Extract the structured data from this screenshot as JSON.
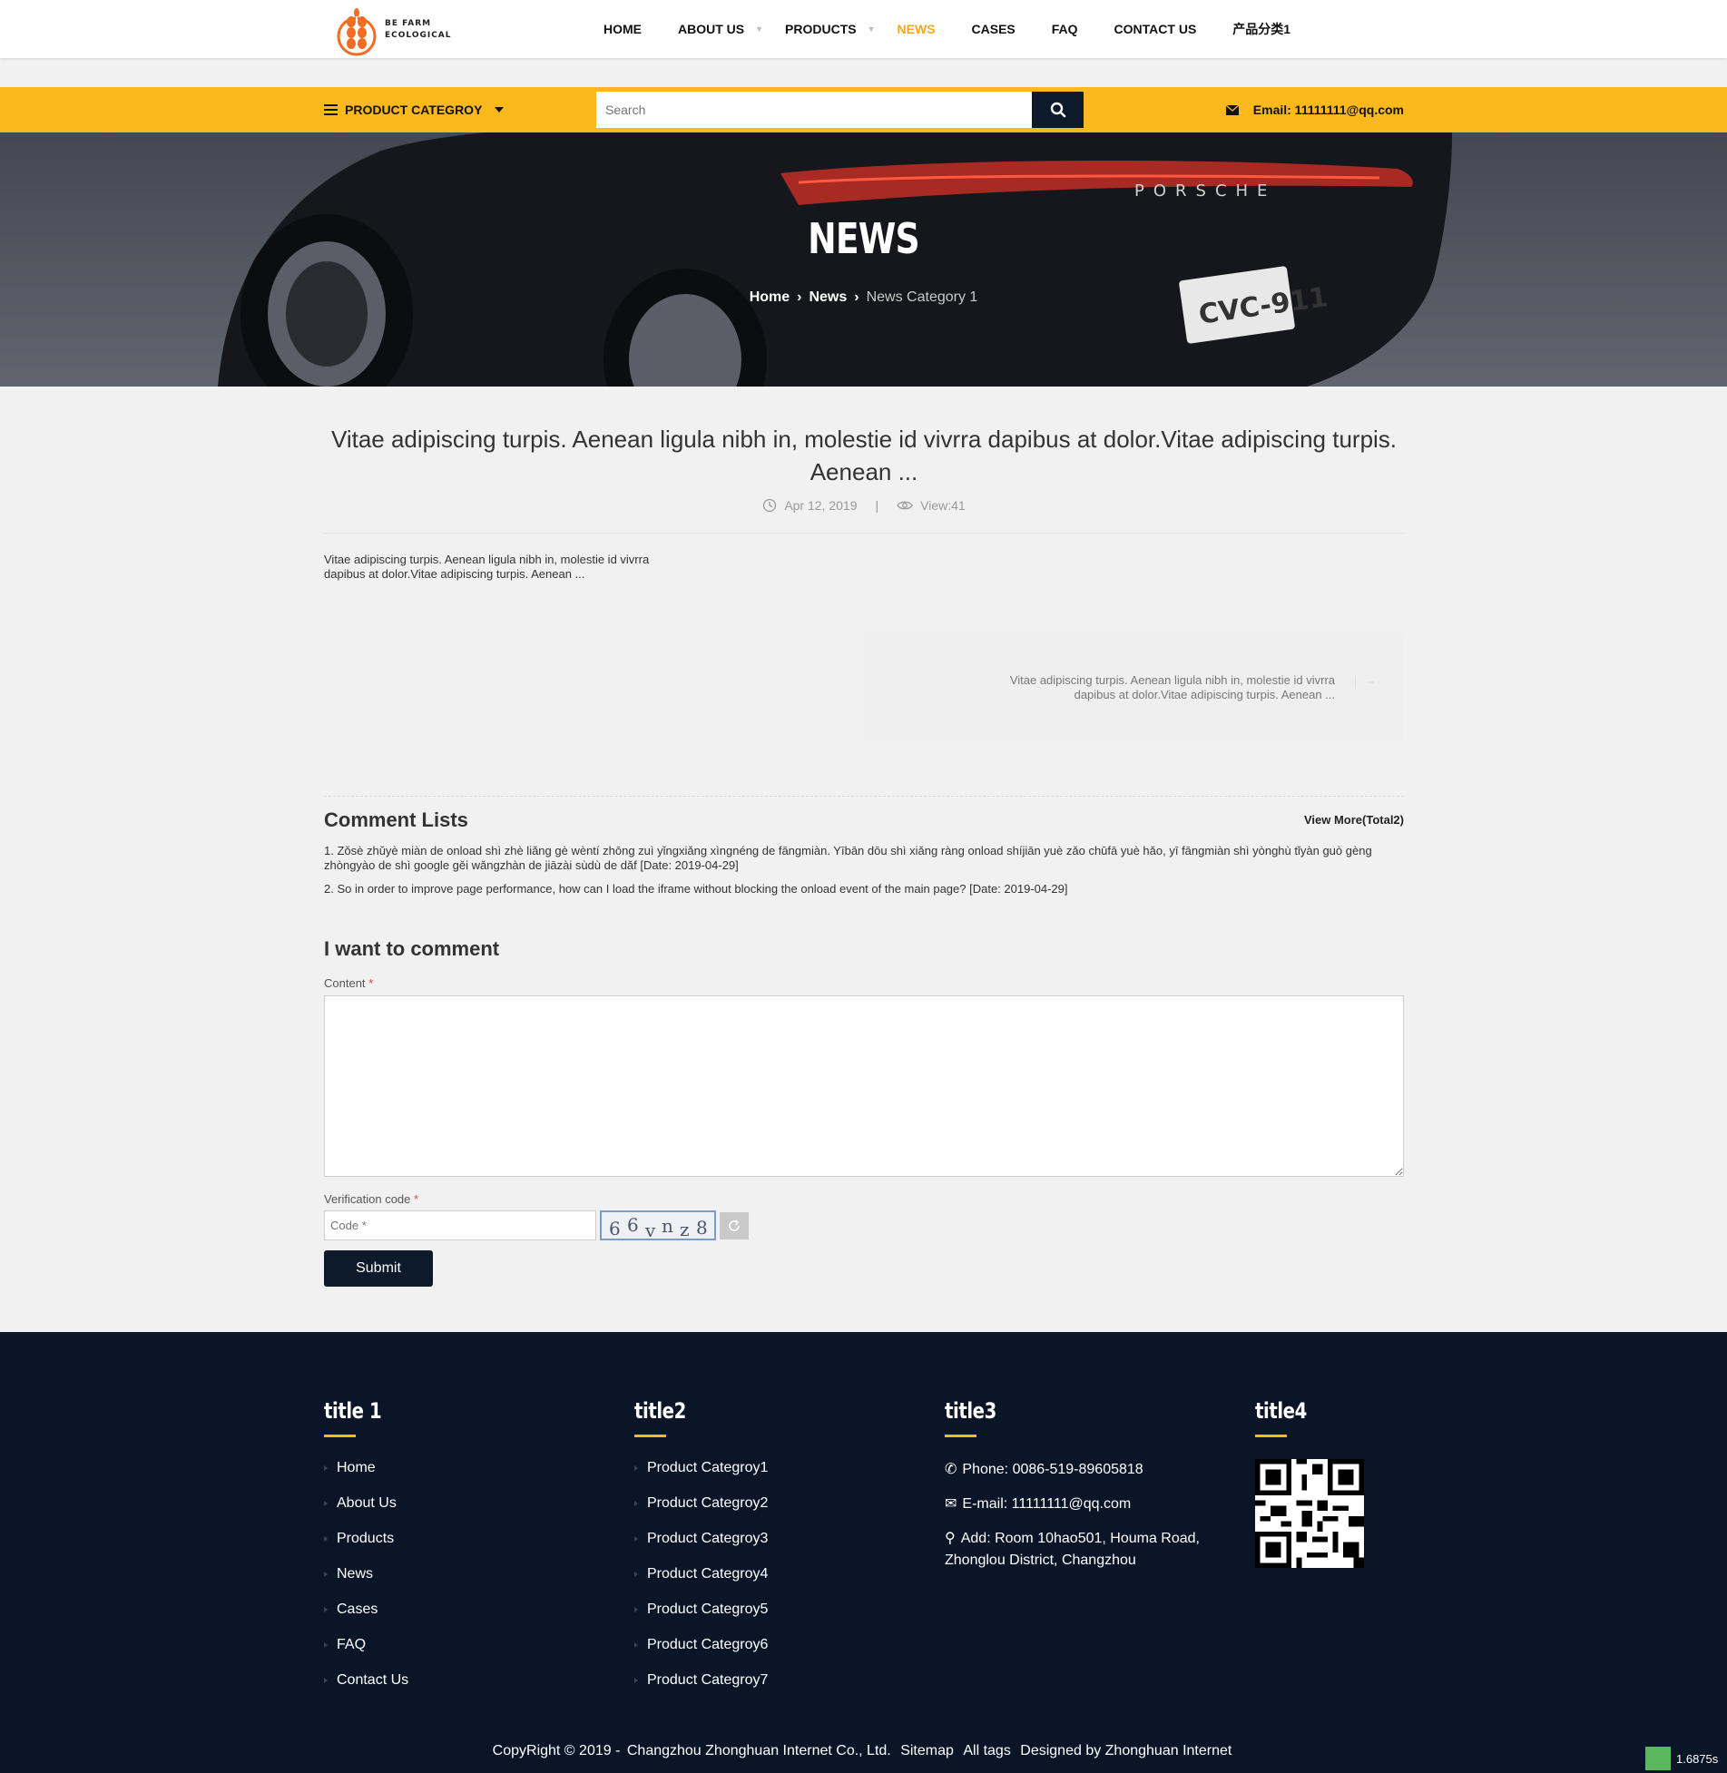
{
  "logo": {
    "line1": "BE FARM",
    "line2": "ECOLOGICAL"
  },
  "nav": {
    "items": [
      {
        "label": "HOME",
        "active": false,
        "dropdown": false
      },
      {
        "label": "ABOUT US",
        "active": false,
        "dropdown": true
      },
      {
        "label": "PRODUCTS",
        "active": false,
        "dropdown": true
      },
      {
        "label": "NEWS",
        "active": true,
        "dropdown": false
      },
      {
        "label": "CASES",
        "active": false,
        "dropdown": false
      },
      {
        "label": "FAQ",
        "active": false,
        "dropdown": false
      },
      {
        "label": "CONTACT US",
        "active": false,
        "dropdown": false
      },
      {
        "label": "产品分类1",
        "active": false,
        "dropdown": false
      }
    ]
  },
  "topbar": {
    "category_label": "PRODUCT CATEGROY",
    "search_placeholder": "Search",
    "email": "Email: 11111111@qq.com"
  },
  "banner": {
    "title": "NEWS",
    "crumbs": [
      "Home",
      "News",
      "News Category 1"
    ]
  },
  "article": {
    "title": "Vitae adipiscing turpis. Aenean ligula nibh in, molestie id vivrra dapibus at dolor.Vitae adipiscing turpis. Aenean ...",
    "date": "Apr 12, 2019",
    "divider": "|",
    "views": "View:41",
    "summary": "Vitae adipiscing turpis. Aenean ligula nibh in, molestie id vivrra dapibus at dolor.Vitae adipiscing turpis. Aenean  ...",
    "next": "Vitae adipiscing turpis. Aenean ligula nibh in, molestie id vivrra dapibus at dolor.Vitae adipiscing turpis. Aenean ..."
  },
  "comments": {
    "title": "Comment Lists",
    "more": "View More(Total2)",
    "items": [
      "1. Zǒsè zhǔyè miàn de onload shì zhè liǎng gè wèntí zhōng zuì yǐngxiǎng xìngnéng de fāngmiàn. Yībān dōu shì xiǎng ràng onload shíjiān yuè zǎo chūfā yuè hǎo, yī fāngmiàn shì yònghù tǐyàn guò gèng zhòngyào de shì google gěi wǎngzhàn de jiāzài sùdù de dǎf [Date: 2019-04-29]",
      "2. So in order to improve page performance, how can I load the iframe without blocking the onload event of the main page? [Date: 2019-04-29]"
    ]
  },
  "form": {
    "title": "I want to comment",
    "content_label": "Content",
    "required_mark": "*",
    "code_label": "Verification code",
    "code_placeholder": "Code *",
    "captcha": [
      "6",
      "6",
      "v",
      "n",
      "z",
      "8"
    ],
    "submit": "Submit"
  },
  "footer": {
    "col1": {
      "title": "title 1",
      "links": [
        "Home",
        "About Us",
        "Products",
        "News",
        "Cases",
        "FAQ",
        "Contact Us"
      ]
    },
    "col2": {
      "title": "title2",
      "links": [
        "Product Categroy1",
        "Product Categroy2",
        "Product Categroy3",
        "Product Categroy4",
        "Product Categroy5",
        "Product Categroy6",
        "Product Categroy7"
      ]
    },
    "col3": {
      "title": "title3",
      "phone": "Phone: 0086-519-89605818",
      "email": "E-mail: 11111111@qq.com",
      "address": "Add: Room 10hao501, Houma Road, Zhonglou District, Changzhou"
    },
    "col4": {
      "title": "title4"
    },
    "copyright": "CopyRight © 2019 -",
    "company": "Changzhou Zhonghuan Internet Co., Ltd.",
    "sitemap": "Sitemap",
    "tags": "All tags",
    "designer": "Designed by Zhonghuan Internet"
  },
  "timer": "1.6875s",
  "colors": {
    "accent": "#fbb91e",
    "dark": "#0b1528",
    "active_nav": "#f5a623"
  }
}
